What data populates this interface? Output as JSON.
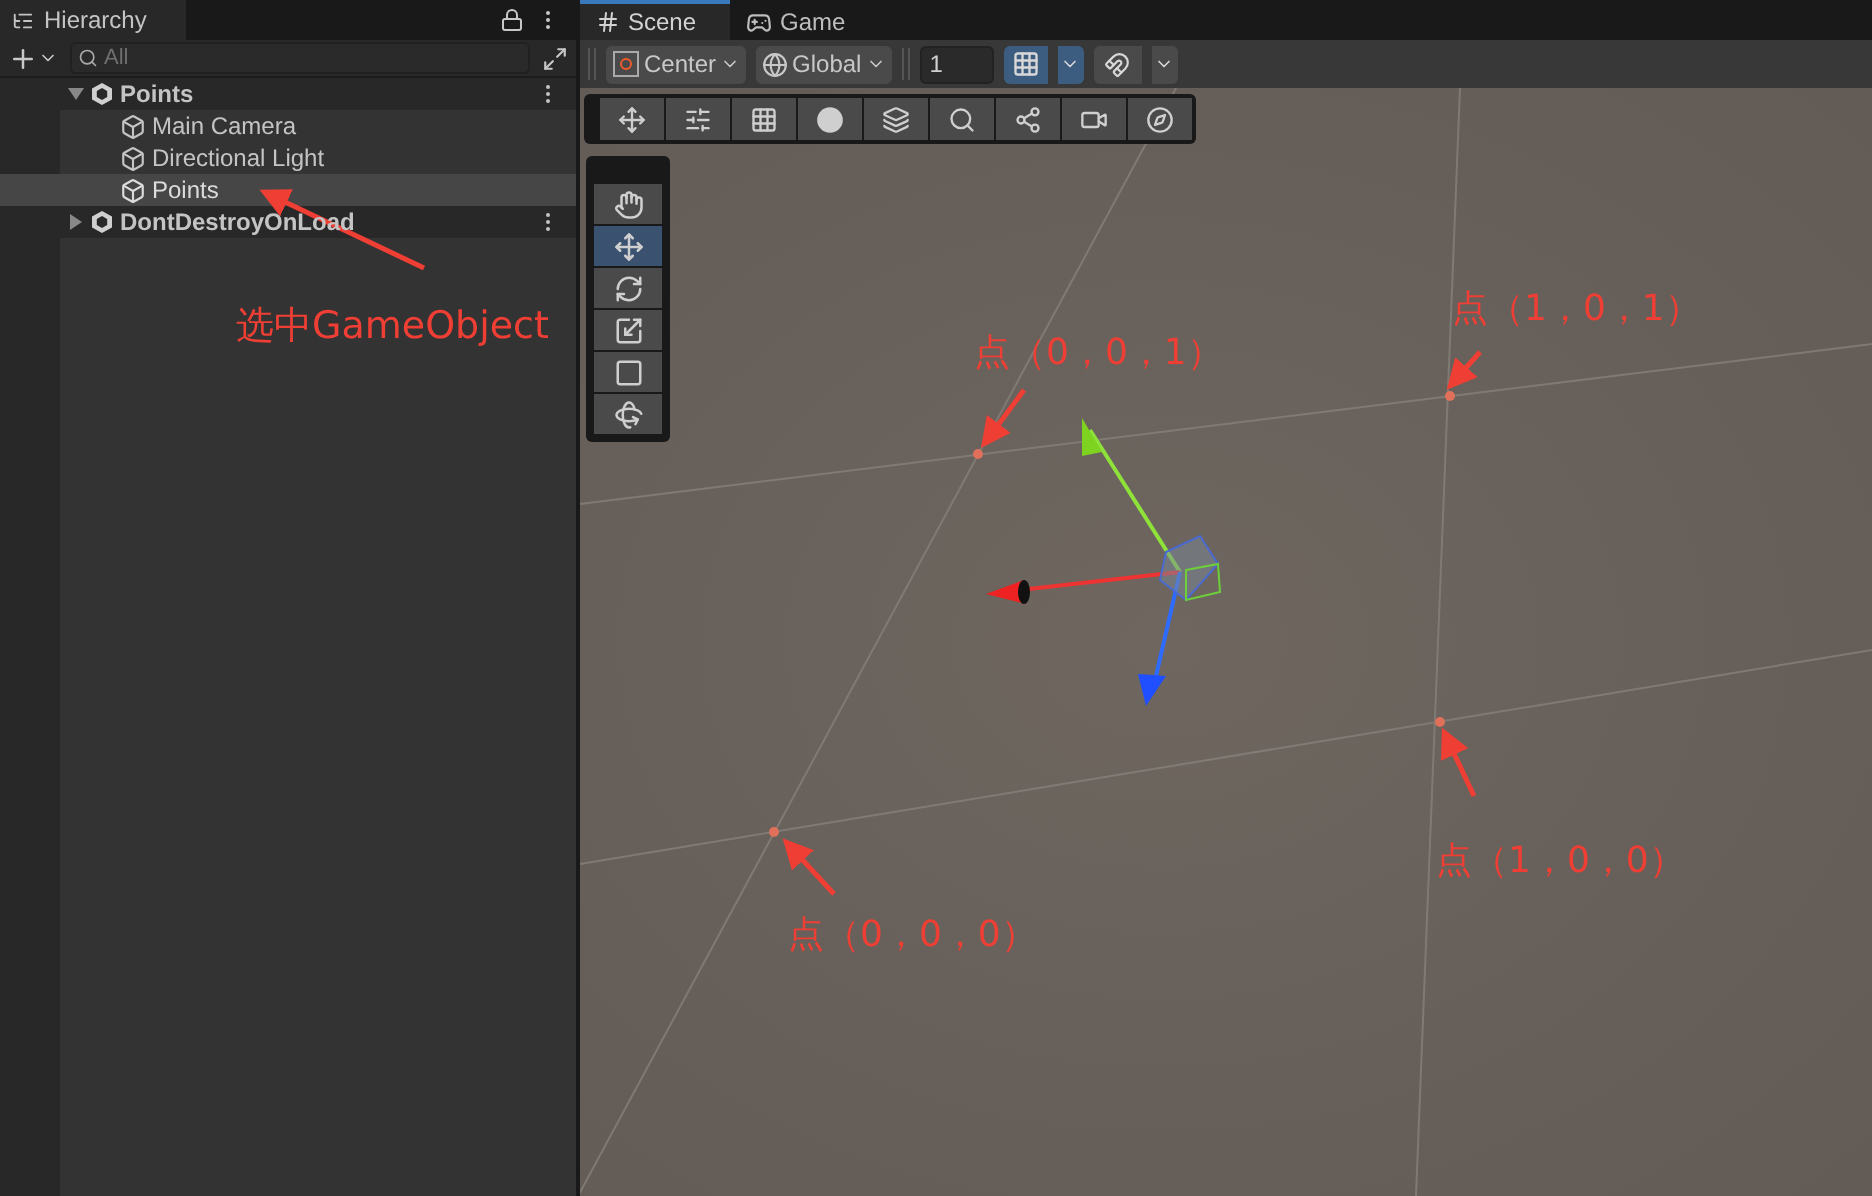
{
  "hierarchy": {
    "title": "Hierarchy",
    "search": {
      "placeholder": "All"
    },
    "items": [
      {
        "label": "Points",
        "kind": "scene",
        "expanded": true,
        "selected": false,
        "children": [
          {
            "label": "Main Camera",
            "kind": "object",
            "selected": false
          },
          {
            "label": "Directional Light",
            "kind": "object",
            "selected": false
          },
          {
            "label": "Points",
            "kind": "object",
            "selected": true
          }
        ]
      },
      {
        "label": "DontDestroyOnLoad",
        "kind": "scene",
        "expanded": false,
        "selected": false
      }
    ]
  },
  "tabs": [
    {
      "label": "Scene",
      "kind": "scene",
      "selected": true
    },
    {
      "label": "Game",
      "kind": "game",
      "selected": false
    }
  ],
  "scene_toolbar": {
    "pivot": "Center",
    "space": "Global",
    "grid_size": "1",
    "grid_snap_on": true
  },
  "tools": [
    {
      "kind": "hand",
      "selected": false
    },
    {
      "kind": "move",
      "selected": true
    },
    {
      "kind": "rotate",
      "selected": false
    },
    {
      "kind": "scale",
      "selected": false
    },
    {
      "kind": "rect",
      "selected": false
    },
    {
      "kind": "transform",
      "selected": false
    }
  ],
  "annotations": [
    {
      "text": "选中GameObject"
    },
    {
      "text": "点（0，0，1）"
    },
    {
      "text": "点（1，0，1）"
    },
    {
      "text": "点（1，0，0）"
    },
    {
      "text": "点（0，0，0）"
    }
  ]
}
